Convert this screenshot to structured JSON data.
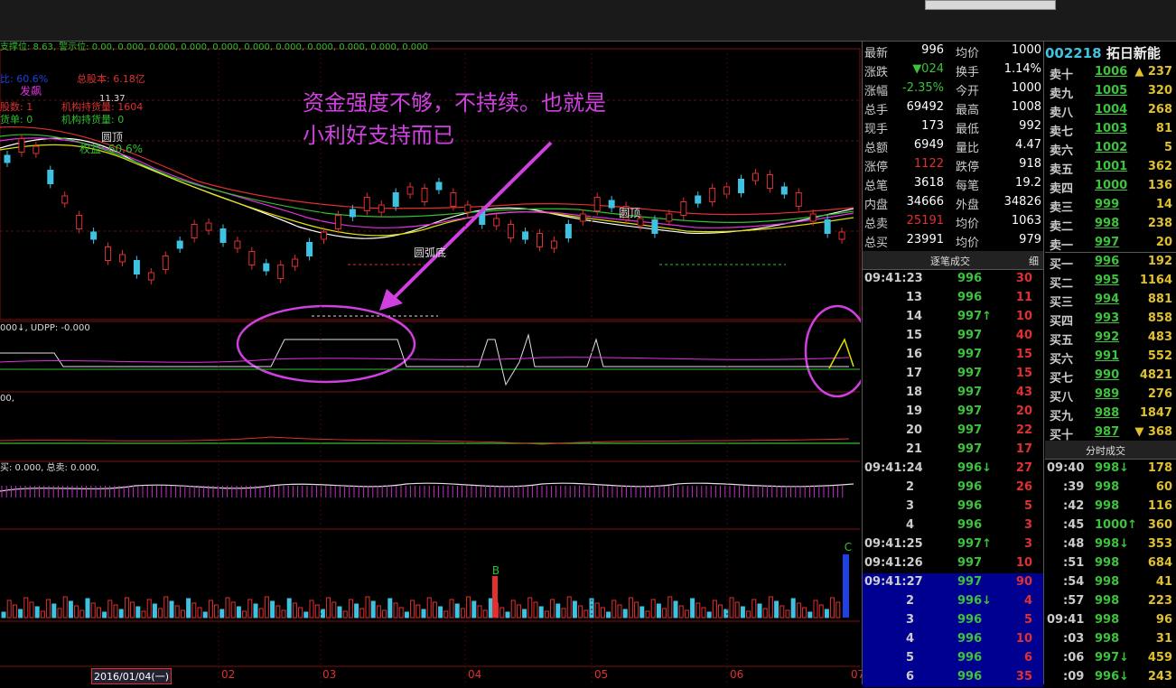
{
  "toolbar": {},
  "chart": {
    "header_line": "支撑位: 8.63, 警示位: 0.00, 0.000, 0.000, 0.000, 0.000, 0.000, 0.000, 0.000, 0.000, 0.000, 0.000",
    "info_lines": [
      "比: 60.6%",
      "总股本: 6.18亿",
      "发飙",
      "11.37",
      "股数: 1",
      "机构持货量: 1604",
      "货单: 0",
      "机构持货量: 0",
      "权益: 60.6%",
      "圆顶",
      "圆顶",
      "圆弧底"
    ],
    "annotation": [
      "资金强度不够，不持续。也就是",
      "小利好支持而已"
    ],
    "sub1": "000↓, UDPP: -0.000",
    "sub2": "00,",
    "sub3": "买: 0.000, 总卖: 0.000,",
    "x_labels": [
      "02",
      "03",
      "04",
      "05",
      "06",
      "07"
    ],
    "date_box": "2016/01/04(一)"
  },
  "quote": {
    "rows": [
      {
        "k": "最新",
        "v": "996",
        "k2": "均价",
        "v2": "1000"
      },
      {
        "k": "涨跌",
        "v": "▼024",
        "k2": "换手",
        "v2": "1.14%"
      },
      {
        "k": "涨幅",
        "v": "-2.35%",
        "k2": "今开",
        "v2": "1000"
      },
      {
        "k": "总手",
        "v": "69492",
        "k2": "最高",
        "v2": "1008"
      },
      {
        "k": "现手",
        "v": "173",
        "k2": "最低",
        "v2": "992"
      },
      {
        "k": "总额",
        "v": "6949",
        "k2": "量比",
        "v2": "4.47"
      },
      {
        "k": "涨停",
        "v": "1122",
        "k2": "跌停",
        "v2": "918"
      },
      {
        "k": "总笔",
        "v": "3618",
        "k2": "每笔",
        "v2": "19.2"
      },
      {
        "k": "内盘",
        "v": "34666",
        "k2": "外盘",
        "v2": "34826"
      },
      {
        "k": "总卖",
        "v": "25191",
        "k2": "均价",
        "v2": "1063"
      },
      {
        "k": "总买",
        "v": "23991",
        "k2": "均价",
        "v2": "979"
      }
    ]
  },
  "ticks": {
    "tab_label": "逐笔成交",
    "tab_detail": "细",
    "rows": [
      {
        "t": "09:41:23",
        "p": "996",
        "v": "30"
      },
      {
        "t": "13",
        "p": "996",
        "v": "11"
      },
      {
        "t": "14",
        "p": "997↑",
        "v": "10"
      },
      {
        "t": "15",
        "p": "997",
        "v": "40"
      },
      {
        "t": "16",
        "p": "997",
        "v": "15"
      },
      {
        "t": "17",
        "p": "997",
        "v": "15"
      },
      {
        "t": "18",
        "p": "997",
        "v": "43"
      },
      {
        "t": "19",
        "p": "997",
        "v": "20"
      },
      {
        "t": "20",
        "p": "997",
        "v": "22"
      },
      {
        "t": "21",
        "p": "997",
        "v": "17"
      },
      {
        "t": "09:41:24",
        "p": "996↓",
        "v": "27"
      },
      {
        "t": "2",
        "p": "996",
        "v": "26"
      },
      {
        "t": "3",
        "p": "996",
        "v": "5"
      },
      {
        "t": "4",
        "p": "996",
        "v": "3"
      },
      {
        "t": "09:41:25",
        "p": "997↑",
        "v": "3"
      },
      {
        "t": "09:41:26",
        "p": "997",
        "v": "10"
      },
      {
        "t": "09:41:27",
        "p": "997",
        "v": "90"
      },
      {
        "t": "2",
        "p": "996↓",
        "v": "4"
      },
      {
        "t": "3",
        "p": "996",
        "v": "5"
      },
      {
        "t": "4",
        "p": "996",
        "v": "10"
      },
      {
        "t": "5",
        "p": "996",
        "v": "6"
      },
      {
        "t": "6",
        "p": "996",
        "v": "35"
      }
    ]
  },
  "book": {
    "code": "002218",
    "name": "拓日新能",
    "rows": [
      {
        "k": "卖十",
        "p": "1006",
        "v": "▲ 237"
      },
      {
        "k": "卖九",
        "p": "1005",
        "v": "320"
      },
      {
        "k": "卖八",
        "p": "1004",
        "v": "268"
      },
      {
        "k": "卖七",
        "p": "1003",
        "v": "81"
      },
      {
        "k": "卖六",
        "p": "1002",
        "v": "5"
      },
      {
        "k": "卖五",
        "p": "1001",
        "v": "362"
      },
      {
        "k": "卖四",
        "p": "1000",
        "v": "136"
      },
      {
        "k": "卖三",
        "p": "999",
        "v": "14"
      },
      {
        "k": "卖二",
        "p": "998",
        "v": "238"
      },
      {
        "k": "卖一",
        "p": "997",
        "v": "20"
      },
      {
        "k": "买一",
        "p": "996",
        "v": "192"
      },
      {
        "k": "买二",
        "p": "995",
        "v": "1164"
      },
      {
        "k": "买三",
        "p": "994",
        "v": "881"
      },
      {
        "k": "买四",
        "p": "993",
        "v": "858"
      },
      {
        "k": "买五",
        "p": "992",
        "v": "483"
      },
      {
        "k": "买六",
        "p": "991",
        "v": "552"
      },
      {
        "k": "买七",
        "p": "990",
        "v": "4821"
      },
      {
        "k": "买八",
        "p": "989",
        "v": "276"
      },
      {
        "k": "买九",
        "p": "988",
        "v": "1847"
      },
      {
        "k": "买十",
        "p": "987",
        "v": "▼ 368"
      }
    ]
  },
  "fenshi": {
    "tab_label": "分时成交",
    "rows": [
      {
        "t": "09:40",
        "p": "998↓",
        "v": "178"
      },
      {
        "t": ":39",
        "p": "998",
        "v": "60"
      },
      {
        "t": ":42",
        "p": "998",
        "v": "116"
      },
      {
        "t": ":45",
        "p": "1000↑",
        "v": "360"
      },
      {
        "t": ":48",
        "p": "998↓",
        "v": "353"
      },
      {
        "t": ":51",
        "p": "998",
        "v": "684"
      },
      {
        "t": ":54",
        "p": "998",
        "v": "41"
      },
      {
        "t": ":57",
        "p": "998",
        "v": "223"
      },
      {
        "t": "09:41",
        "p": "998",
        "v": "96"
      },
      {
        "t": ":03",
        "p": "998",
        "v": "31"
      },
      {
        "t": ":06",
        "p": "997↓",
        "v": "459"
      },
      {
        "t": ":09",
        "p": "996↓",
        "v": "243"
      }
    ]
  }
}
